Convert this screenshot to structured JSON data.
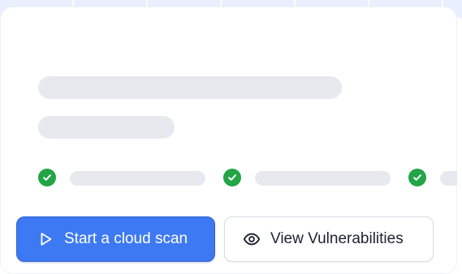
{
  "actions": {
    "primary_label": "Start a cloud scan",
    "secondary_label": "View Vulnerabilities"
  },
  "colors": {
    "primary": "#3d79f2",
    "success": "#22a447",
    "skeleton": "#e7e9ee"
  },
  "icons": {
    "primary": "play-icon",
    "secondary": "eye-icon",
    "status": "check-circle-icon"
  }
}
